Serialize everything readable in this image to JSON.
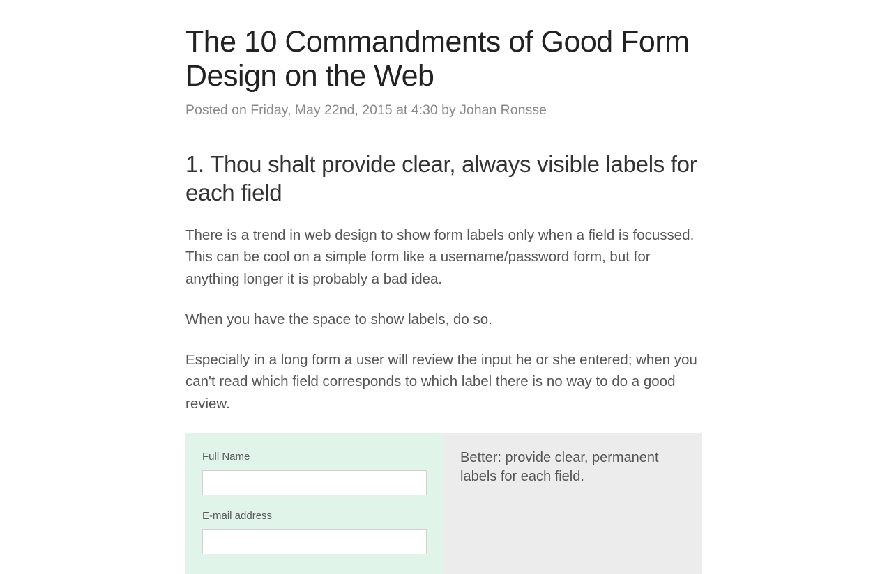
{
  "header": {
    "title": "The 10 Commandments of Good Form Design on the Web",
    "meta": "Posted on Friday, May 22nd, 2015 at 4:30 by Johan Ronsse"
  },
  "section": {
    "heading": "1. Thou shalt provide clear, always visible labels for each field",
    "paragraphs": [
      "There is a trend in web design to show form labels only when a field is focussed. This can be cool on a simple form like a username/password form, but for anything longer it is probably a bad idea.",
      "When you have the space to show labels, do so.",
      "Especially in a long form a user will review the input he or she entered; when you can't read which field corresponds to which label there is no way to do a good review."
    ]
  },
  "example": {
    "fields": [
      {
        "label": "Full Name"
      },
      {
        "label": "E-mail address"
      }
    ],
    "caption": "Better: provide clear, permanent labels for each field."
  }
}
